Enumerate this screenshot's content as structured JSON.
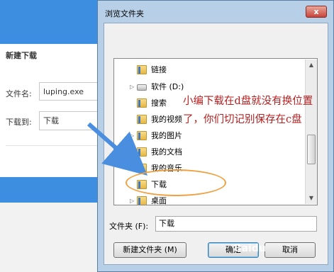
{
  "background_window": {
    "title": "新建下载",
    "filename_label": "文件名:",
    "filename_value": "luping.exe",
    "save_to_label": "下载到:",
    "save_to_value": "下载"
  },
  "dialog": {
    "title": "浏览文件夹",
    "close_label": "x",
    "tree": [
      {
        "label": "链接",
        "icon": "folder-icon"
      },
      {
        "label": "软件 (D:)",
        "icon": "drive-icon"
      },
      {
        "label": "搜索",
        "icon": "folder-icon"
      },
      {
        "label": "我的视频",
        "icon": "folder-icon"
      },
      {
        "label": "我的图片",
        "icon": "folder-icon"
      },
      {
        "label": "我的文档",
        "icon": "folder-icon"
      },
      {
        "label": "我的音乐",
        "icon": "folder-icon"
      },
      {
        "label": "下载",
        "icon": "folder-icon"
      },
      {
        "label": "桌面",
        "icon": "folder-icon"
      }
    ],
    "folder_label": "文件夹 (F):",
    "folder_value": "下载",
    "buttons": {
      "new_folder": "新建文件夹 (M)",
      "ok": "确定",
      "cancel": "取消"
    }
  },
  "annotation": {
    "text": "小编下载在d盘就没有换位置了，你们切记别保存在c盘",
    "color": "#b52020"
  },
  "watermark": "Baidu"
}
